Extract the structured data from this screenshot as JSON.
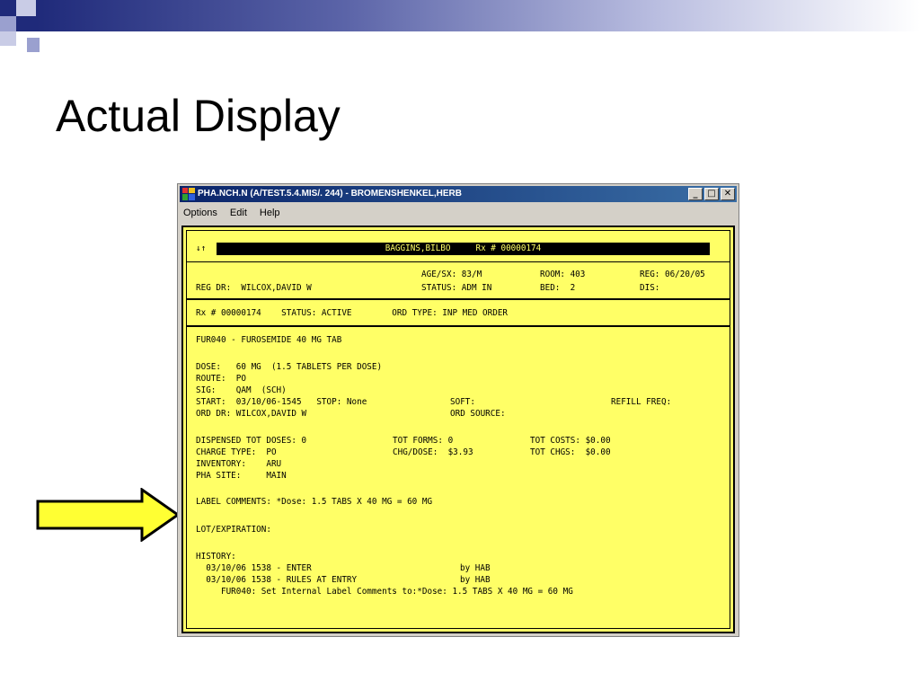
{
  "slide": {
    "title": "Actual Display"
  },
  "window": {
    "title": "PHA.NCH.N (A/TEST.5.4.MIS/. 244) - BROMENSHENKEL,HERB",
    "buttons": {
      "minimize": "_",
      "maximize": "□",
      "close": "✕"
    },
    "menu": [
      "Options",
      "Edit",
      "Help"
    ]
  },
  "terminal": {
    "sort_glyph": "↓↑",
    "header": "BAGGINS,BILBO     Rx # 00000174",
    "reg_dr": "REG DR:  WILCOX,DAVID W",
    "age_sx": "AGE/SX: 83/M",
    "status": "STATUS: ADM IN",
    "room": "ROOM: 403",
    "bed": "BED:  2",
    "reg": "REG: 06/20/05",
    "dis": "DIS:",
    "rx_line": "Rx # 00000174    STATUS: ACTIVE        ORD TYPE: INP MED ORDER",
    "drug": "FUR040 - FUROSEMIDE 40 MG TAB",
    "dose": "DOSE:   60 MG  (1.5 TABLETS PER DOSE)",
    "route": "ROUTE:  PO",
    "sig": "SIG:    QAM  (SCH)",
    "start": "START:  03/10/06-1545   STOP: None",
    "soft": "SOFT:",
    "refill": "REFILL FREQ:",
    "ord_dr": "ORD DR: WILCOX,DAVID W",
    "ord_source": "ORD SOURCE:",
    "dispensed": "DISPENSED TOT DOSES: 0",
    "tot_forms": "TOT FORMS: 0",
    "tot_costs": "TOT COSTS: $0.00",
    "charge_type": "CHARGE TYPE:  PO",
    "chg_dose": "CHG/DOSE:  $3.93",
    "tot_chgs": "TOT CHGS:  $0.00",
    "inventory": "INVENTORY:    ARU",
    "pha_site": "PHA SITE:     MAIN",
    "label_comments": "LABEL COMMENTS: *Dose: 1.5 TABS X 40 MG = 60 MG",
    "lot_expiration": "LOT/EXPIRATION:",
    "history_label": "HISTORY:",
    "history": [
      {
        "entry": "  03/10/06 1538 - ENTER",
        "by": "by HAB"
      },
      {
        "entry": "  03/10/06 1538 - RULES AT ENTRY",
        "by": "by HAB"
      }
    ],
    "history_detail": "     FUR040: Set Internal Label Comments to:*Dose: 1.5 TABS X 40 MG = 60 MG"
  },
  "colors": {
    "terminal_bg": "#ffff66",
    "arrow_fill": "#ffff33",
    "slide_accent": "#1f2a7a"
  }
}
